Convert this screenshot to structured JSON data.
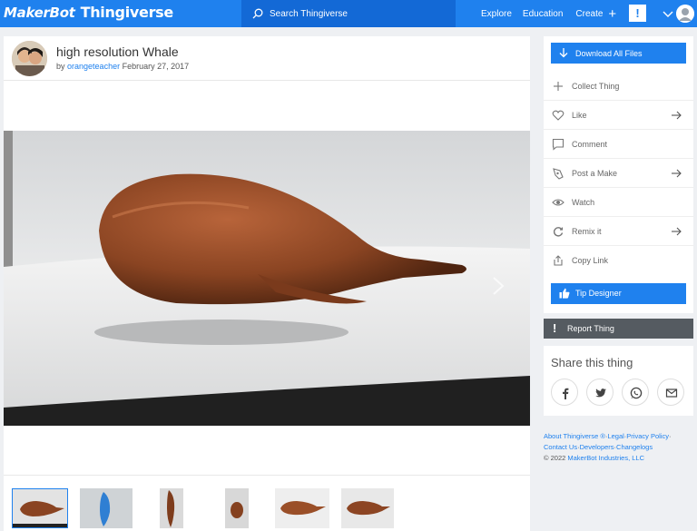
{
  "nav": {
    "logo_makerbot": "MakerBot",
    "logo_thingiverse": "Thingiverse",
    "search_placeholder": "Search Thingiverse",
    "explore": "Explore",
    "education": "Education",
    "create": "Create",
    "alert": "!"
  },
  "thing": {
    "title": "high resolution Whale",
    "by": "by",
    "author": "orangeteacher",
    "date": "February 27, 2017"
  },
  "sidebar": {
    "download_label": "Download All Files",
    "items": [
      {
        "label": "Collect Thing",
        "icon": "plus-icon"
      },
      {
        "label": "Like",
        "icon": "heart-icon"
      },
      {
        "label": "Comment",
        "icon": "comment-icon"
      },
      {
        "label": "Post a Make",
        "icon": "make-icon"
      },
      {
        "label": "Watch",
        "icon": "eye-icon"
      },
      {
        "label": "Remix it",
        "icon": "remix-icon"
      },
      {
        "label": "Copy Link",
        "icon": "share-icon"
      }
    ],
    "tip_label": "Tip Designer",
    "report_label": "Report Thing"
  },
  "share": {
    "title": "Share this thing",
    "buttons": [
      "facebook-icon",
      "twitter-icon",
      "whatsapp-icon",
      "mail-icon"
    ]
  },
  "footer": {
    "about": "About Thingiverse ®",
    "legal": "Legal",
    "privacy": "Privacy Policy",
    "contact": "Contact Us",
    "developers": "Developers",
    "changelogs": "Changelogs",
    "copyright_prefix": "©  2022",
    "company": "MakerBot Industries, LLC"
  },
  "colors": {
    "brand_blue": "#1f81ee",
    "report_gray": "#555b61"
  }
}
